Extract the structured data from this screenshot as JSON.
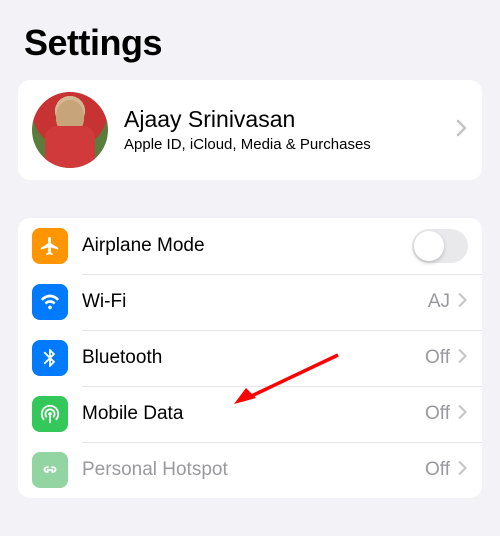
{
  "header": {
    "title": "Settings"
  },
  "profile": {
    "name": "Ajaay Srinivasan",
    "subtitle": "Apple ID, iCloud, Media & Purchases"
  },
  "rows": {
    "airplane": {
      "label": "Airplane Mode"
    },
    "wifi": {
      "label": "Wi-Fi",
      "value": "AJ"
    },
    "bluetooth": {
      "label": "Bluetooth",
      "value": "Off"
    },
    "mobiledata": {
      "label": "Mobile Data",
      "value": "Off"
    },
    "hotspot": {
      "label": "Personal Hotspot",
      "value": "Off"
    }
  }
}
